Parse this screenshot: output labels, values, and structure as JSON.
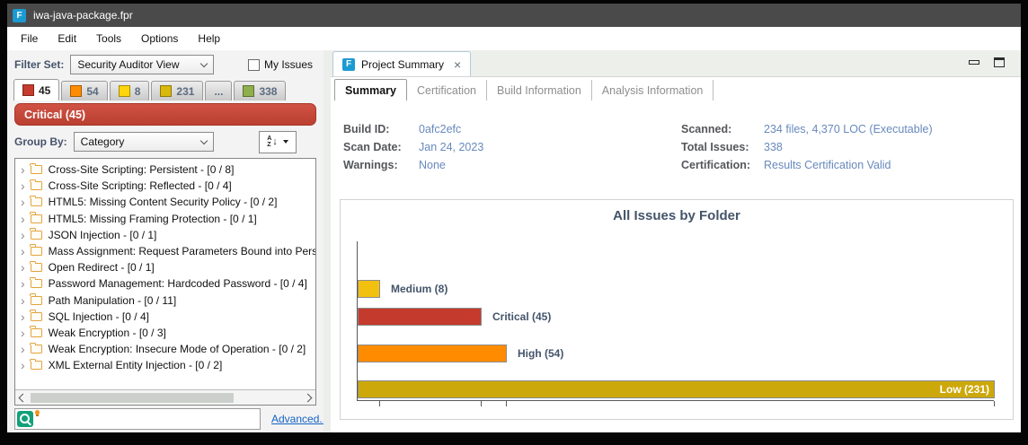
{
  "window": {
    "title": "iwa-java-package.fpr"
  },
  "menu": {
    "items": [
      "File",
      "Edit",
      "Tools",
      "Options",
      "Help"
    ]
  },
  "left_panel": {
    "filter_set_label": "Filter Set:",
    "filter_set_value": "Security Auditor View",
    "my_issues_label": "My Issues",
    "severity_tabs": [
      {
        "count": "45",
        "color": "#c53b2d",
        "active": true
      },
      {
        "count": "54",
        "color": "#ff8c00",
        "active": false
      },
      {
        "count": "8",
        "color": "#ffd60a",
        "active": false
      },
      {
        "count": "231",
        "color": "#d9b80e",
        "active": false
      },
      {
        "count": "...",
        "color": null,
        "active": false
      },
      {
        "count": "338",
        "color": "#8fae4e",
        "active": false
      }
    ],
    "selected_severity_banner": "Critical (45)",
    "group_by_label": "Group By:",
    "group_by_value": "Category",
    "tree_items": [
      "Cross-Site Scripting: Persistent - [0 / 8]",
      "Cross-Site Scripting: Reflected - [0 / 4]",
      "HTML5: Missing Content Security Policy - [0 / 2]",
      "HTML5: Missing Framing Protection - [0 / 1]",
      "JSON Injection - [0 / 1]",
      "Mass Assignment: Request Parameters Bound into Persi",
      "Open Redirect - [0 / 1]",
      "Password Management: Hardcoded Password - [0 / 4]",
      "Path Manipulation - [0 / 11]",
      "SQL Injection - [0 / 4]",
      "Weak Encryption - [0 / 3]",
      "Weak Encryption: Insecure Mode of Operation - [0 / 2]",
      "XML External Entity Injection - [0 / 2]"
    ],
    "search": {
      "value": "",
      "advanced_label": "Advanced..."
    }
  },
  "right_panel": {
    "editor_tab": "Project Summary",
    "tabs": [
      "Summary",
      "Certification",
      "Build Information",
      "Analysis Information"
    ],
    "active_tab": "Summary",
    "info": {
      "left": [
        {
          "label": "Build ID:",
          "value": "0afc2efc"
        },
        {
          "label": "Scan Date:",
          "value": "Jan 24, 2023"
        },
        {
          "label": "Warnings:",
          "value": "None"
        }
      ],
      "right": [
        {
          "label": "Scanned:",
          "value": "234 files, 4,370 LOC (Executable)"
        },
        {
          "label": "Total Issues:",
          "value": "338"
        },
        {
          "label": "Certification:",
          "value": "Results Certification Valid"
        }
      ]
    }
  },
  "chart_data": {
    "type": "bar",
    "orientation": "horizontal",
    "title": "All Issues by Folder",
    "categories": [
      "Medium",
      "Critical",
      "High",
      "Low"
    ],
    "values": [
      8,
      45,
      54,
      231
    ],
    "colors": [
      "#f2c110",
      "#c43b2d",
      "#ff8c00",
      "#cda80a"
    ],
    "label_format": "{category} ({value})",
    "label_positions": [
      "right",
      "right",
      "right",
      "inside"
    ],
    "xlim": [
      0,
      231
    ],
    "x_ticks": [
      8,
      45,
      54,
      231
    ],
    "grid": false,
    "legend": "none"
  }
}
